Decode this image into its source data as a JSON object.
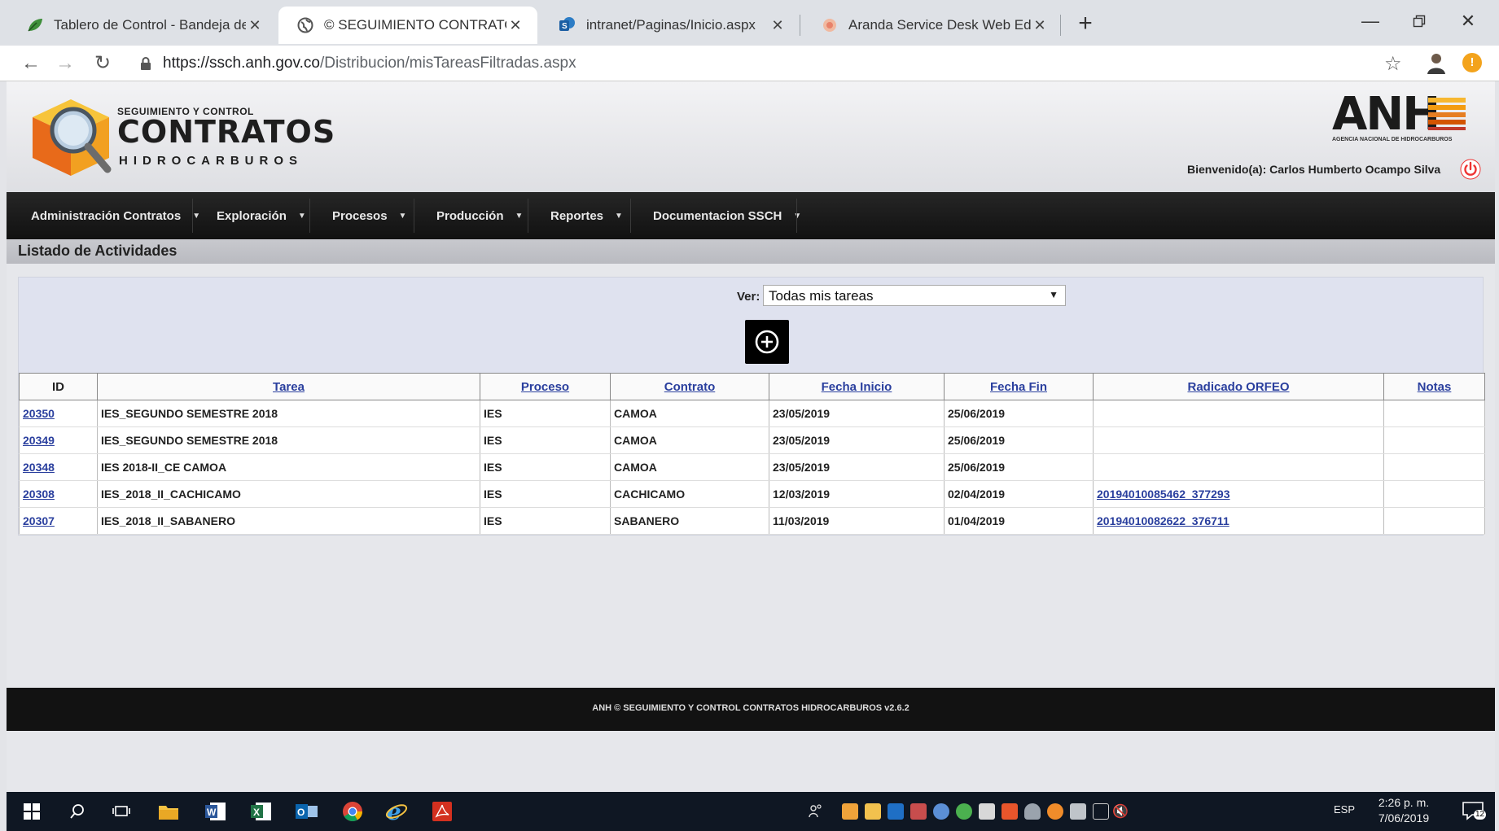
{
  "browser": {
    "tabs": [
      {
        "label": "Tablero de Control - Bandeja de",
        "active": false
      },
      {
        "label": "© SEGUIMIENTO CONTRATOS v.",
        "active": true
      },
      {
        "label": "intranet/Paginas/Inicio.aspx",
        "active": false
      },
      {
        "label": "Aranda Service Desk Web Edition",
        "active": false
      }
    ],
    "close_glyph": "✕",
    "new_tab_glyph": "+",
    "url_host": "https://ssch.anh.gov.co",
    "url_path": "/Distribucion/misTareasFiltradas.aspx"
  },
  "header": {
    "logo_top": "SEGUIMIENTO Y CONTROL",
    "logo_main": "CONTRATOS",
    "logo_bottom": "HIDROCARBUROS",
    "anh_logo": "ANH",
    "anh_sub": "AGENCIA NACIONAL DE HIDROCARBUROS",
    "welcome": "Bienvenido(a): Carlos Humberto Ocampo Silva"
  },
  "nav": {
    "items": [
      "Administración Contratos",
      "Exploración",
      "Procesos",
      "Producción",
      "Reportes",
      "Documentacion SSCH"
    ]
  },
  "list": {
    "title": "Listado de Actividades",
    "ver_label": "Ver:",
    "ver_value": "Todas mis tareas",
    "columns": [
      "ID",
      "Tarea",
      "Proceso",
      "Contrato",
      "Fecha Inicio",
      "Fecha Fin",
      "Radicado ORFEO",
      "Notas"
    ],
    "rows": [
      {
        "id": "20350",
        "tarea": "IES_SEGUNDO SEMESTRE 2018",
        "proceso": "IES",
        "contrato": "CAMOA",
        "inicio": "23/05/2019",
        "fin": "25/06/2019",
        "radicado": "",
        "notas": ""
      },
      {
        "id": "20349",
        "tarea": "IES_SEGUNDO SEMESTRE 2018",
        "proceso": "IES",
        "contrato": "CAMOA",
        "inicio": "23/05/2019",
        "fin": "25/06/2019",
        "radicado": "",
        "notas": ""
      },
      {
        "id": "20348",
        "tarea": "IES 2018-II_CE CAMOA",
        "proceso": "IES",
        "contrato": "CAMOA",
        "inicio": "23/05/2019",
        "fin": "25/06/2019",
        "radicado": "",
        "notas": ""
      },
      {
        "id": "20308",
        "tarea": "IES_2018_II_CACHICAMO",
        "proceso": "IES",
        "contrato": "CACHICAMO",
        "inicio": "12/03/2019",
        "fin": "02/04/2019",
        "radicado": "20194010085462_377293",
        "notas": ""
      },
      {
        "id": "20307",
        "tarea": "IES_2018_II_SABANERO",
        "proceso": "IES",
        "contrato": "SABANERO",
        "inicio": "11/03/2019",
        "fin": "01/04/2019",
        "radicado": "20194010082622_376711",
        "notas": ""
      }
    ]
  },
  "footer": {
    "text": "ANH © SEGUIMIENTO Y CONTROL CONTRATOS HIDROCARBUROS v2.6.2"
  },
  "taskbar": {
    "lang": "ESP",
    "time": "2:26 p. m.",
    "date": "7/06/2019",
    "notifications": "12"
  }
}
